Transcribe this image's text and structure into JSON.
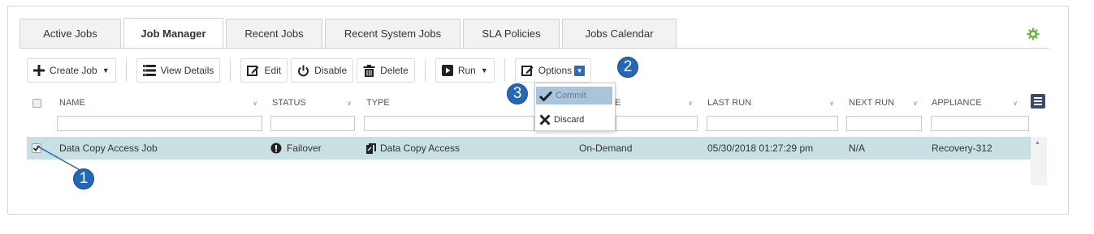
{
  "tabs": [
    {
      "label": "Active Jobs",
      "active": false
    },
    {
      "label": "Job Manager",
      "active": true
    },
    {
      "label": "Recent Jobs",
      "active": false
    },
    {
      "label": "Recent System Jobs",
      "active": false
    },
    {
      "label": "SLA Policies",
      "active": false
    },
    {
      "label": "Jobs Calendar",
      "active": false
    }
  ],
  "toolbar": {
    "create_job": "Create Job",
    "view_details": "View Details",
    "edit": "Edit",
    "disable": "Disable",
    "delete": "Delete",
    "run": "Run",
    "options": "Options"
  },
  "options_menu": {
    "items": [
      {
        "label": "Commit",
        "icon": "check-icon",
        "selected": true
      },
      {
        "label": "Discard",
        "icon": "x-icon",
        "selected": false
      }
    ]
  },
  "grid": {
    "columns": [
      "NAME",
      "STATUS",
      "TYPE",
      "E",
      "LAST RUN",
      "NEXT RUN",
      "APPLIANCE"
    ],
    "rows": [
      {
        "checked": true,
        "name": "Data Copy Access Job",
        "status": "Failover",
        "type": "Data Copy Access",
        "schedule": "On-Demand",
        "last_run": "05/30/2018 01:27:29 pm",
        "next_run": "N/A",
        "appliance": "Recovery-312"
      }
    ]
  },
  "callouts": [
    "1",
    "2",
    "3"
  ],
  "colors": {
    "accent": "#2567b5",
    "row_selected": "#c9e0e3",
    "gear": "#6bb33a",
    "menu_selected": "#a9c4dc",
    "status_icon": "#222222"
  }
}
